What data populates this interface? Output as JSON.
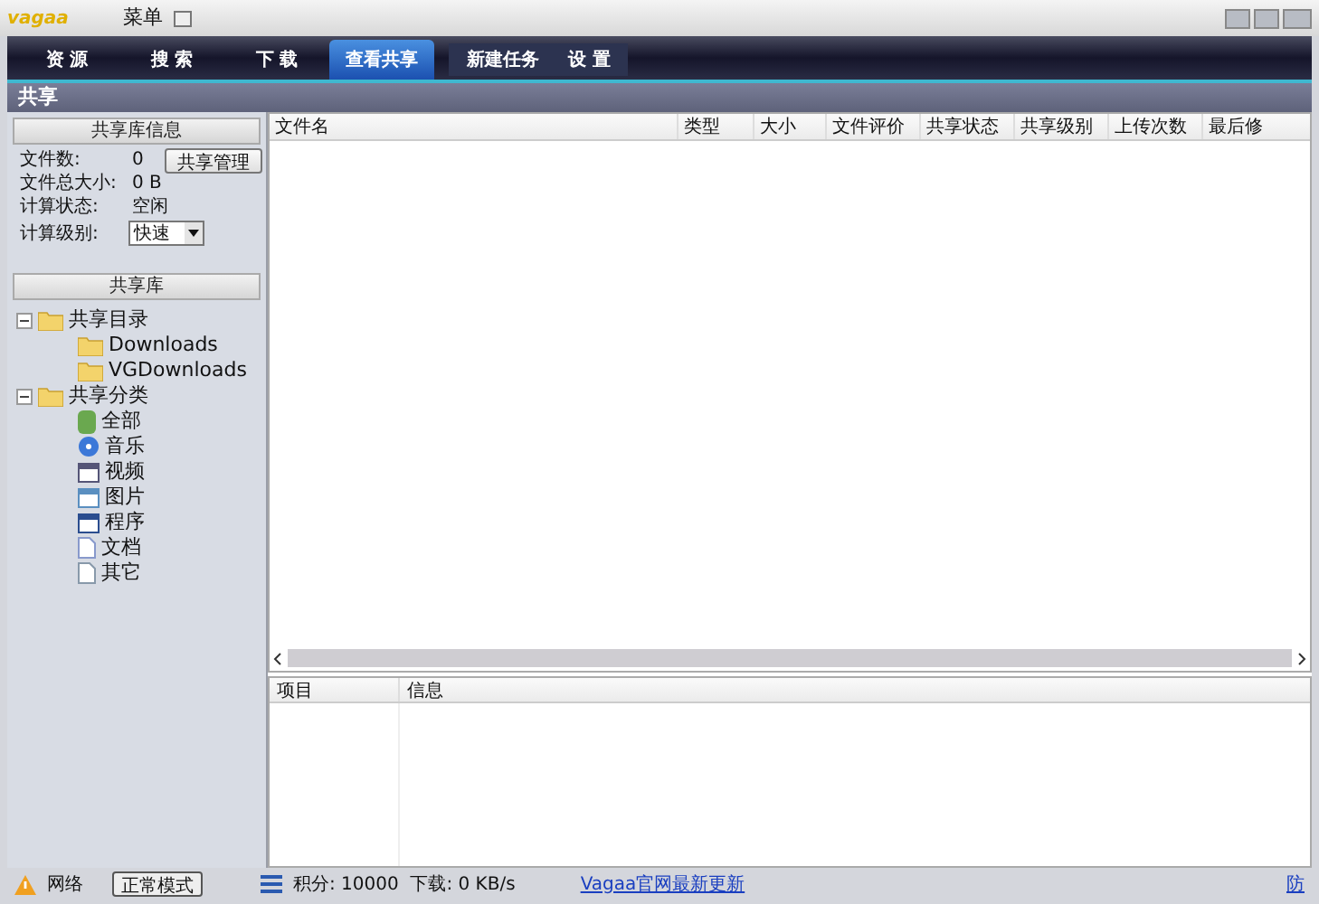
{
  "window": {
    "logo": "vagaa",
    "menu": "菜单"
  },
  "tabs": [
    {
      "label": "资 源",
      "selected": false
    },
    {
      "label": "搜 索",
      "selected": false
    },
    {
      "label": "下 载",
      "selected": false
    },
    {
      "label": "查看共享",
      "selected": true
    }
  ],
  "actions": [
    "新建任务",
    "设 置"
  ],
  "page_title": "共享",
  "library_info": {
    "header": "共享库信息",
    "manage_button": "共享管理",
    "rows": [
      {
        "label": "文件数:",
        "value": "0"
      },
      {
        "label": "文件总大小:",
        "value": "0 B"
      },
      {
        "label": "计算状态:",
        "value": "空闲"
      }
    ],
    "level_label": "计算级别:",
    "level_value": "快速"
  },
  "library": {
    "header": "共享库",
    "tree": [
      {
        "label": "共享目录",
        "kind": "folder",
        "expanded": true,
        "children": [
          {
            "label": "Downloads",
            "kind": "folder"
          },
          {
            "label": "VGDownloads",
            "kind": "folder"
          }
        ]
      },
      {
        "label": "共享分类",
        "kind": "folder",
        "expanded": true,
        "children": [
          {
            "label": "全部",
            "kind": "all"
          },
          {
            "label": "音乐",
            "kind": "music"
          },
          {
            "label": "视频",
            "kind": "video"
          },
          {
            "label": "图片",
            "kind": "image"
          },
          {
            "label": "程序",
            "kind": "program"
          },
          {
            "label": "文档",
            "kind": "doc"
          },
          {
            "label": "其它",
            "kind": "other"
          }
        ]
      }
    ]
  },
  "file_table": {
    "columns": [
      "文件名",
      "类型",
      "大小",
      "文件评价",
      "共享状态",
      "共享级别",
      "上传次数",
      "最后修"
    ]
  },
  "info_table": {
    "columns": [
      "项目",
      "信息"
    ]
  },
  "status_bar": {
    "network": "网络",
    "mode": "正常模式",
    "stats": "积分: 10000  下载: 0 KB/s",
    "link": "Vagaa官网最新更新",
    "right": "防"
  }
}
